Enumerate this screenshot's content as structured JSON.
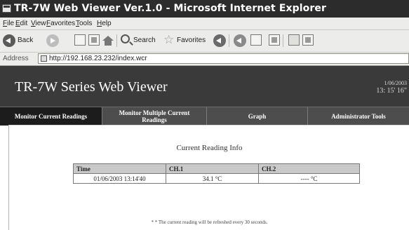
{
  "window": {
    "title": "TR-7W Web Viewer Ver.1.0 - Microsoft Internet Explorer",
    "icon": "ie-page-icon"
  },
  "menu": [
    "File",
    "Edit",
    "View",
    "Favorites",
    "Tools",
    "Help"
  ],
  "toolbar": {
    "back_label": "Back",
    "search_label": "Search",
    "favorites_label": "Favorites"
  },
  "address": {
    "label": "Address",
    "url": "http://192.168.23.232/index.wcr"
  },
  "banner": {
    "title": "TR-7W Series Web Viewer",
    "date": "1/06/2003",
    "time": "13: 15' 16\""
  },
  "nav": [
    {
      "label": "Monitor Current Readings",
      "active": true
    },
    {
      "label": "Monitor Multiple Current Readings",
      "active": false
    },
    {
      "label": "Graph",
      "active": false
    },
    {
      "label": "Administrator Tools",
      "active": false
    }
  ],
  "content": {
    "heading": "Current Reading Info",
    "table": {
      "headers": [
        "Time",
        "CH.1",
        "CH.2"
      ],
      "row": [
        "01/06/2003 13:14'40",
        "34.1 °C",
        "---- °C"
      ]
    },
    "note": "* * The current reading will be refreshed every 30 seconds."
  },
  "colors": {
    "titlebar": "#2c2c2c",
    "banner": "#3a3a3a",
    "nav": "#4d4d4d",
    "nav_active": "#1c1c1c",
    "table_header": "#c9c9c9"
  }
}
